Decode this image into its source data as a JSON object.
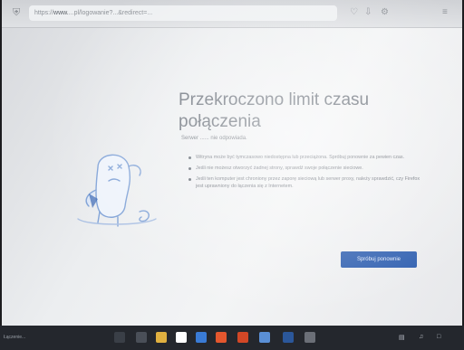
{
  "browser": {
    "url_prefix": "https://",
    "url_host": "www.",
    "url_rest": "...pl/logowanie?...&redirect=...",
    "icons": [
      "shield-icon",
      "pocket-icon",
      "downloads-icon",
      "extensions-icon",
      "menu-icon"
    ]
  },
  "error": {
    "title": "Przekroczono limit czasu połączenia",
    "description": "Serwer ...... nie odpowiada.",
    "bullets": [
      "Witryna może być tymczasowo niedostępna lub przeciążona. Spróbuj ponownie za pewien czas.",
      "Jeśli nie możesz otworzyć żadnej strony, sprawdź swoje połączenie sieciowe.",
      "Jeśli ten komputer jest chroniony przez zaporę sieciową lub serwer proxy, należy sprawdzić, czy Firefox jest uprawniony do łączenia się z Internetem."
    ],
    "retry_label": "Spróbuj ponownie"
  },
  "taskbar": {
    "status_text": "Łączenie...",
    "apps": [
      {
        "name": "search-icon",
        "color": "#3a3f47"
      },
      {
        "name": "task-view-icon",
        "color": "#4a4f58"
      },
      {
        "name": "file-explorer-icon",
        "color": "#e0b040"
      },
      {
        "name": "store-icon",
        "color": "#ffffff"
      },
      {
        "name": "mail-icon",
        "color": "#3a7bd5"
      },
      {
        "name": "firefox-icon",
        "color": "#e4572e"
      },
      {
        "name": "office-icon",
        "color": "#d24726"
      },
      {
        "name": "photos-icon",
        "color": "#5a8fd6"
      },
      {
        "name": "word-icon",
        "color": "#2b579a"
      },
      {
        "name": "calculator-icon",
        "color": "#6b6f77"
      }
    ]
  }
}
